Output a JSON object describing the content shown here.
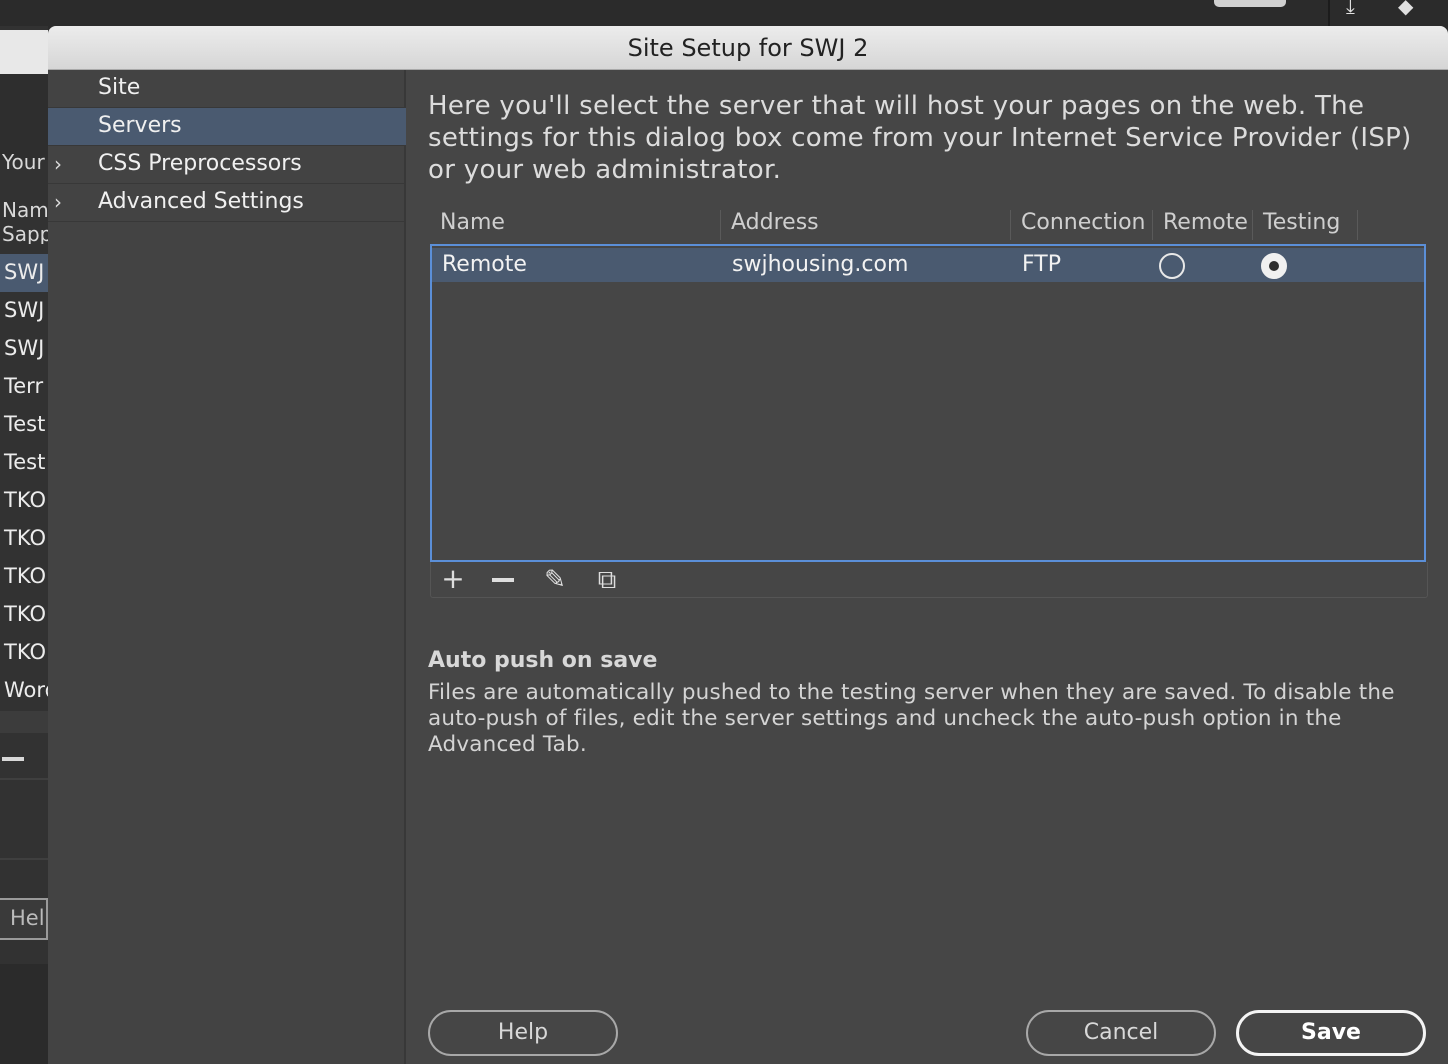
{
  "dialog": {
    "title": "Site Setup for SWJ 2",
    "categories": [
      {
        "label": "Site",
        "expandable": false,
        "selected": false
      },
      {
        "label": "Servers",
        "expandable": false,
        "selected": true
      },
      {
        "label": "CSS Preprocessors",
        "expandable": true,
        "selected": false
      },
      {
        "label": "Advanced Settings",
        "expandable": true,
        "selected": false
      }
    ],
    "intro": "Here you'll select the server that will host your pages on the web. The settings for this dialog box come from your Internet Service Provider (ISP) or your web administrator.",
    "columns": {
      "name": "Name",
      "address": "Address",
      "connection": "Connection",
      "remote": "Remote",
      "testing": "Testing"
    },
    "servers": [
      {
        "name": "Remote",
        "address": "swjhousing.com",
        "connection": "FTP",
        "remote": false,
        "testing": true
      }
    ],
    "toolbar": {
      "add_symbol": "+",
      "edit_symbol": "✎",
      "duplicate_symbol": "⧉"
    },
    "autopush": {
      "title": "Auto push on save",
      "description": "Files are automatically pushed to the testing server when they are saved. To disable the auto-push of files, edit the server settings and uncheck the auto-push option in the Advanced Tab."
    },
    "buttons": {
      "help": "Help",
      "cancel": "Cancel",
      "save": "Save"
    }
  },
  "background_window": {
    "your_label": "Your",
    "name_label": "Nam",
    "partial_item": "Sapp",
    "site_list": [
      "SWJ",
      "SWJ",
      "SWJ",
      "Terr",
      "Test",
      "Test",
      "TKO",
      "TKO",
      "TKO",
      "TKO",
      "TKO",
      "Word"
    ],
    "help_label": "Hel",
    "toolbar_icons": [
      "download-icon",
      "tag-icon"
    ]
  },
  "colors": {
    "selection": "#4a5a70",
    "focus_border": "#5b8fd8",
    "dialog_bg": "#464646"
  }
}
